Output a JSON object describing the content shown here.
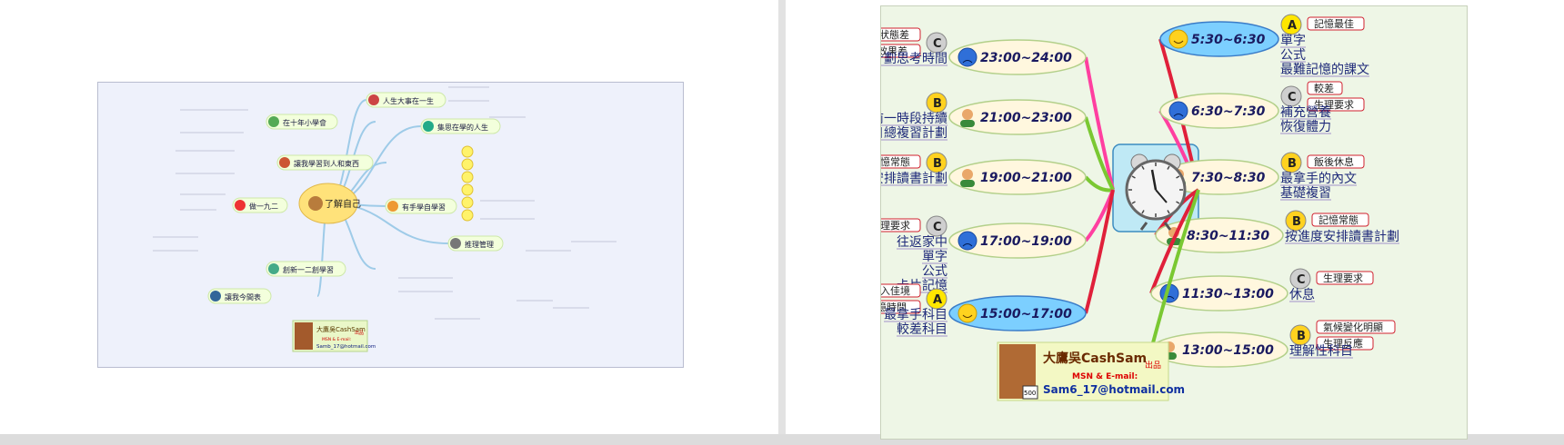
{
  "left_map": {
    "center": "了解自己",
    "branches": [
      {
        "label": "人生大事在一生"
      },
      {
        "label": "集思在學的人生"
      },
      {
        "label": "有手學自學習"
      },
      {
        "label": "推理管理"
      },
      {
        "label": "讓我學習到人和東西"
      },
      {
        "label": "在十年小學會"
      },
      {
        "label": "做一九二"
      },
      {
        "label": "創新一二創學習"
      },
      {
        "label": "讓我今間表"
      }
    ],
    "credit": {
      "brand": "大鷹吳CashSam",
      "suffix": "出品",
      "line2": "MSN & E-mail:",
      "email": "Samb_17@hotmail.com"
    }
  },
  "right_map": {
    "nodes": [
      {
        "time": "5:30~6:30",
        "grade": "A",
        "face": "smile",
        "side": "right",
        "tags": [
          "記憶最佳"
        ],
        "items": [
          "單字",
          "公式",
          "最難記憶的課文"
        ]
      },
      {
        "time": "6:30~7:30",
        "grade": "C",
        "face": "sad",
        "side": "right",
        "tags": [
          "較差",
          "生理要求"
        ],
        "items": [
          "補充營養",
          "恢復體力"
        ]
      },
      {
        "time": "7:30~8:30",
        "grade": "B",
        "face": "person",
        "side": "right",
        "tags": [
          "飯後休息"
        ],
        "items": [
          "最拿手的內文",
          "基礎複習"
        ]
      },
      {
        "time": "8:30~11:30",
        "grade": "B",
        "face": "person",
        "side": "right",
        "tags": [
          "記憶常態"
        ],
        "items": [
          "按進度安排讀書計劃"
        ]
      },
      {
        "time": "11:30~13:00",
        "grade": "C",
        "face": "sad",
        "side": "right",
        "tags": [
          "生理要求"
        ],
        "items": [
          "休息"
        ]
      },
      {
        "time": "13:00~15:00",
        "grade": "B",
        "face": "person",
        "side": "right",
        "tags": [
          "氣候變化明顯",
          "生理反應"
        ],
        "items": [
          "理解性科目"
        ]
      },
      {
        "time": "23:00~24:00",
        "grade": "C",
        "face": "sad",
        "side": "left",
        "tags": [
          "體態狀態差",
          "勉強記憶效果差"
        ],
        "items": [
          "明日計劃思考時間"
        ]
      },
      {
        "time": "21:00~23:00",
        "grade": "B",
        "face": "person",
        "side": "left",
        "tags": [],
        "items": [
          "按前一時段持續",
          "本日總複習計劃"
        ]
      },
      {
        "time": "19:00~21:00",
        "grade": "B",
        "face": "person",
        "side": "left",
        "tags": [
          "記憶常態"
        ],
        "items": [
          "按進度安排讀書計劃"
        ]
      },
      {
        "time": "17:00~19:00",
        "grade": "C",
        "face": "sad",
        "side": "left",
        "tags": [
          "生理要求"
        ],
        "items": [
          "往返家中",
          "單字",
          "公式",
          "卡片記憶"
        ]
      },
      {
        "time": "15:00~17:00",
        "grade": "A",
        "face": "smile",
        "side": "left",
        "tags": [
          "漸入佳境",
          "一天最常記憶時間"
        ],
        "items": [
          "最拿手科目",
          "較差科目"
        ]
      }
    ],
    "credit": {
      "brand": "大鷹吳CashSam",
      "suffix": "出品",
      "line2": "MSN & E-mail:",
      "email": "Sam6_17@hotmail.com",
      "badge": "500"
    }
  },
  "colors": {
    "slide_bg": "#ffffff",
    "left_panel_bg": "#eef1fb",
    "right_panel_bg": "#eef6e6",
    "grade_a": "#ffe600",
    "grade_b": "#ffd21f",
    "grade_c": "#cfcfcf",
    "time_bubble": "#fff8dc",
    "time_bubble_blue": "#7fd0ff",
    "tag_border": "#d0202e"
  },
  "icons": [
    "alarm-clock-icon",
    "smile-face-icon",
    "sad-face-icon",
    "person-icon",
    "hamburger-icon"
  ]
}
